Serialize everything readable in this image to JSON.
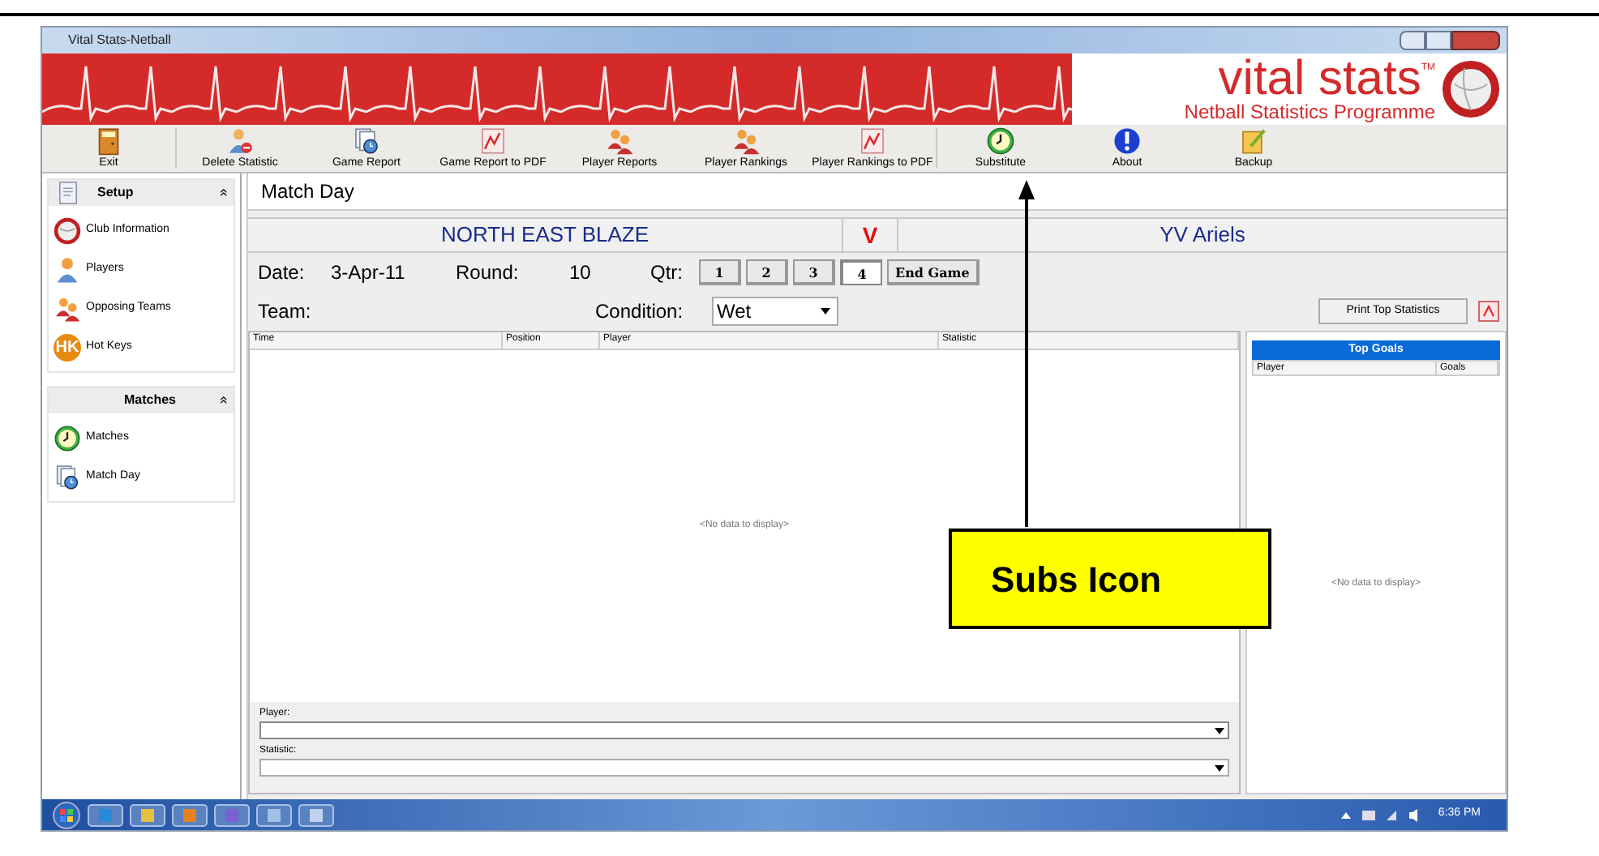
{
  "window": {
    "title": "Vital Stats-Netball"
  },
  "banner": {
    "logo": "vital stats",
    "trademark": "TM",
    "subtitle": "Netball Statistics Programme"
  },
  "toolbar": [
    {
      "label": "Exit",
      "kind": "door"
    },
    {
      "label": "Delete Statistic",
      "kind": "person-minus"
    },
    {
      "label": "Game Report",
      "kind": "report"
    },
    {
      "label": "Game Report to PDF",
      "kind": "pdf"
    },
    {
      "label": "Player Reports",
      "kind": "people"
    },
    {
      "label": "Player Rankings",
      "kind": "people"
    },
    {
      "label": "Player Rankings to PDF",
      "kind": "pdf"
    },
    {
      "label": "Substitute",
      "kind": "clock"
    },
    {
      "label": "About",
      "kind": "info"
    },
    {
      "label": "Backup",
      "kind": "notepad"
    }
  ],
  "sidebar": {
    "groups": [
      {
        "title": "Setup",
        "kind": "page",
        "items": [
          {
            "label": "Club Information",
            "kind": "ball"
          },
          {
            "label": "Players",
            "kind": "person"
          },
          {
            "label": "Opposing Teams",
            "kind": "people"
          },
          {
            "label": "Hot Keys",
            "kind": "hk",
            "badge": "HK"
          }
        ]
      },
      {
        "title": "Matches",
        "kind": "plain",
        "items": [
          {
            "label": "Matches",
            "kind": "clock"
          },
          {
            "label": "Match Day",
            "kind": "report"
          }
        ]
      }
    ],
    "collapse_glyph": "«"
  },
  "match": {
    "title": "Match Day",
    "home_team": "NORTH EAST BLAZE",
    "versus": "V",
    "away_team": "YV Ariels",
    "date_label": "Date:",
    "date": "3-Apr-11",
    "round_label": "Round:",
    "round": "10",
    "qtr_label": "Qtr:",
    "quarters": [
      {
        "label": "1",
        "selected": false
      },
      {
        "label": "2",
        "selected": false
      },
      {
        "label": "3",
        "selected": false
      },
      {
        "label": "4",
        "selected": true
      }
    ],
    "end_game": "End Game",
    "team_label": "Team:",
    "condition_label": "Condition:",
    "condition": "Wet",
    "print_button": "Print Top Statistics",
    "table": {
      "columns": [
        "Time",
        "Position",
        "Player",
        "Statistic"
      ],
      "empty": "<No data to display>"
    },
    "player_label": "Player:",
    "statistic_label": "Statistic:"
  },
  "top_goals": {
    "title": "Top Goals",
    "columns": [
      "Player",
      "Goals"
    ],
    "empty": "<No data to display>"
  },
  "taskbar": {
    "time": "6:36 PM"
  },
  "callout": {
    "text": "Subs Icon"
  }
}
